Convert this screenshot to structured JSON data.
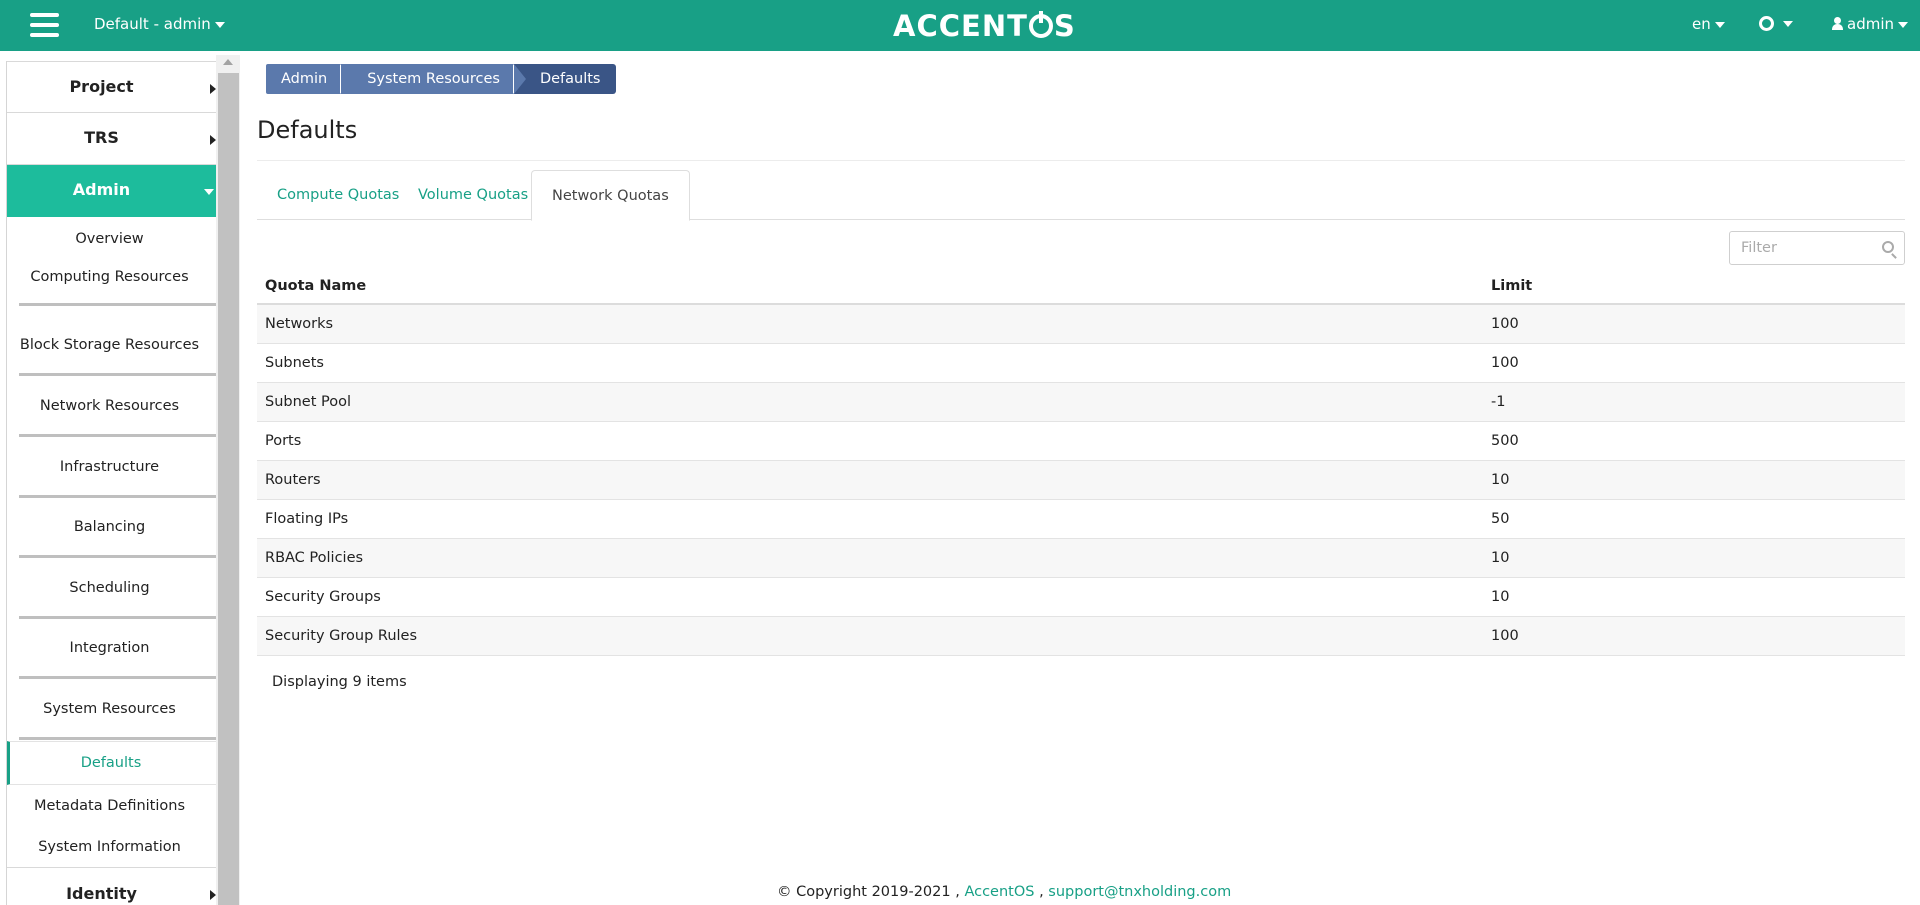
{
  "topbar": {
    "project": "Default - admin",
    "logo": "ACCENTOS",
    "logo_left": "ACCENT",
    "logo_right": "S",
    "language": "en",
    "user": "admin",
    "color": "#18a086"
  },
  "sidebar": {
    "project": "Project",
    "trs": "TRS",
    "admin": "Admin",
    "identity": "Identity",
    "items": {
      "overview": "Overview",
      "computing": "Computing Resources",
      "block_storage": "Block Storage Resources",
      "network": "Network Resources",
      "infrastructure": "Infrastructure",
      "balancing": "Balancing",
      "scheduling": "Scheduling",
      "integration": "Integration",
      "system_resources": "System Resources",
      "defaults": "Defaults",
      "metadata": "Metadata Definitions",
      "system_info": "System Information"
    }
  },
  "breadcrumb": [
    "Admin",
    "System Resources",
    "Defaults"
  ],
  "page": {
    "title": "Defaults"
  },
  "tabs": [
    "Compute Quotas",
    "Volume Quotas",
    "Network Quotas"
  ],
  "filter": {
    "placeholder": "Filter"
  },
  "table": {
    "headers": [
      "Quota Name",
      "Limit"
    ],
    "rows": [
      [
        "Networks",
        "100"
      ],
      [
        "Subnets",
        "100"
      ],
      [
        "Subnet Pool",
        "-1"
      ],
      [
        "Ports",
        "500"
      ],
      [
        "Routers",
        "10"
      ],
      [
        "Floating IPs",
        "50"
      ],
      [
        "RBAC Policies",
        "10"
      ],
      [
        "Security Groups",
        "10"
      ],
      [
        "Security Group Rules",
        "100"
      ]
    ]
  },
  "count": "Displaying 9 items",
  "footer": {
    "copyright": "© Copyright 2019-2021 , ",
    "link1": "AccentOS",
    "sep": " , ",
    "link2": "support@tnxholding.com"
  }
}
